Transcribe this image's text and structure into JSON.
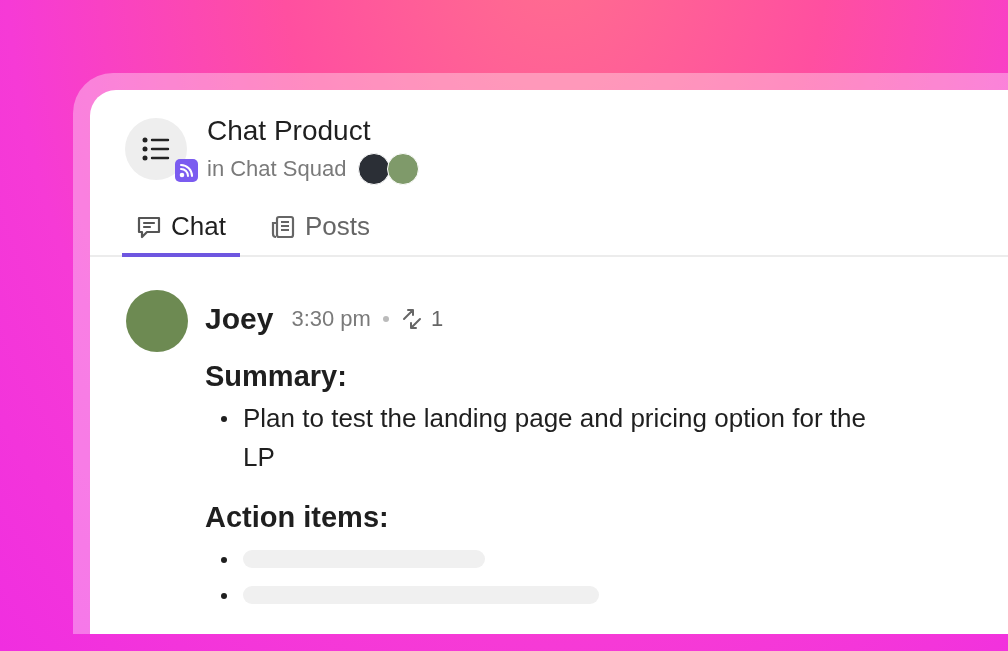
{
  "header": {
    "title": "Chat Product",
    "subtitle": "in Chat Squad",
    "members": [
      {
        "color": "#2b2f36"
      },
      {
        "color": "#7f9a6a"
      }
    ]
  },
  "tabs": [
    {
      "label": "Chat",
      "selected": true
    },
    {
      "label": "Posts",
      "selected": false
    }
  ],
  "message": {
    "author": "Joey",
    "time": "3:30 pm",
    "replies": "1",
    "sections": [
      {
        "heading": "Summary:",
        "bullets": [
          {
            "kind": "text",
            "text": "Plan to test the landing page and pricing option for the LP"
          }
        ]
      },
      {
        "heading": "Action items:",
        "bullets": [
          {
            "kind": "skeleton"
          },
          {
            "kind": "skeleton"
          }
        ]
      }
    ]
  }
}
